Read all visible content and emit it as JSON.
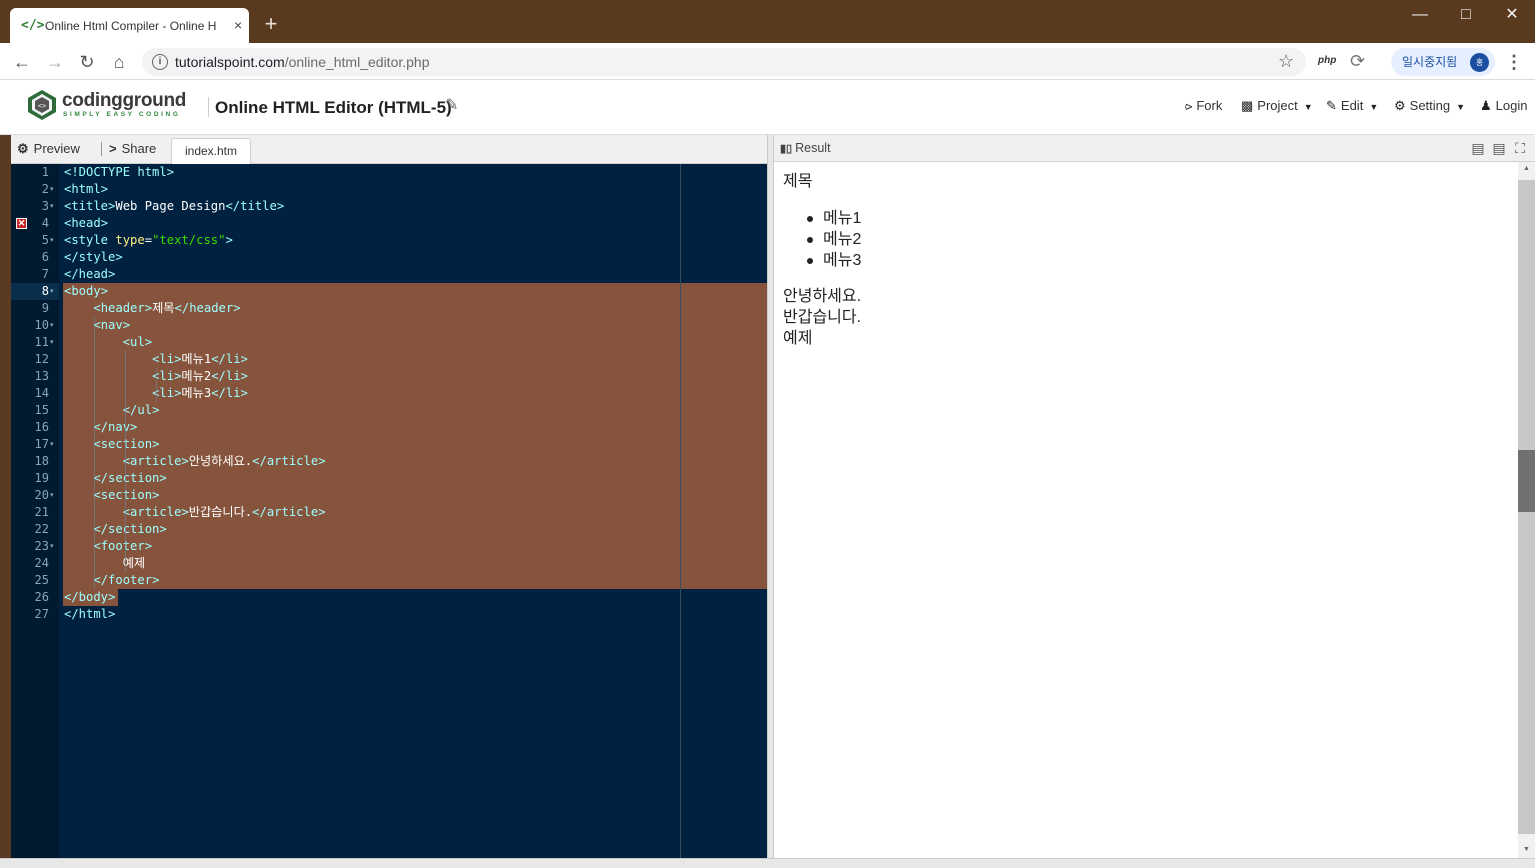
{
  "browser": {
    "tab_title": "Online Html Compiler - Online H",
    "tab_close": "×",
    "new_tab": "+",
    "url_host": "tutorialspoint.com",
    "url_path": "/online_html_editor.php",
    "ext_php": "php",
    "profile_label": "일시중지됨",
    "profile_avatar": "홍"
  },
  "app": {
    "logo_text": "codingground",
    "logo_tagline": "SIMPLY EASY CODING",
    "title": "Online HTML Editor (HTML-5)",
    "menu": {
      "fork": "Fork",
      "project": "Project",
      "edit": "Edit",
      "setting": "Setting",
      "login": "Login"
    }
  },
  "left_toolbar": {
    "preview": "Preview",
    "share": "Share",
    "file_tab": "index.htm"
  },
  "editor": {
    "line_numbers": [
      "1",
      "2",
      "3",
      "4",
      "5",
      "6",
      "7",
      "8",
      "9",
      "10",
      "11",
      "12",
      "13",
      "14",
      "15",
      "16",
      "17",
      "18",
      "19",
      "20",
      "21",
      "22",
      "23",
      "24",
      "25",
      "26",
      "27"
    ],
    "lines": [
      "<!DOCTYPE html>",
      "<html>",
      "<title>Web Page Design</title>",
      "<head>",
      "<style type=\"text/css\">",
      "</style>",
      "</head>",
      "<body>",
      "    <header>제목</header>",
      "    <nav>",
      "        <ul>",
      "            <li>메뉴1</li>",
      "            <li>메뉴2</li>",
      "            <li>메뉴3</li>",
      "        </ul>",
      "    </nav>",
      "    <section>",
      "        <article>안녕하세요.</article>",
      "    </section>",
      "    <section>",
      "        <article>반갑습니다.</article>",
      "    </section>",
      "    <footer>",
      "        예제",
      "    </footer>",
      "</body>",
      "</html>"
    ],
    "colors": {
      "background": "#002240",
      "tag": "#9effff",
      "attr": "#ffee80",
      "string": "#3ad900",
      "selection": "#86543d"
    }
  },
  "result": {
    "title": "Result",
    "header": "제목",
    "menu_items": [
      "메뉴1",
      "메뉴2",
      "메뉴3"
    ],
    "article1": "안녕하세요.",
    "article2": "반갑습니다.",
    "footer": "예제"
  }
}
